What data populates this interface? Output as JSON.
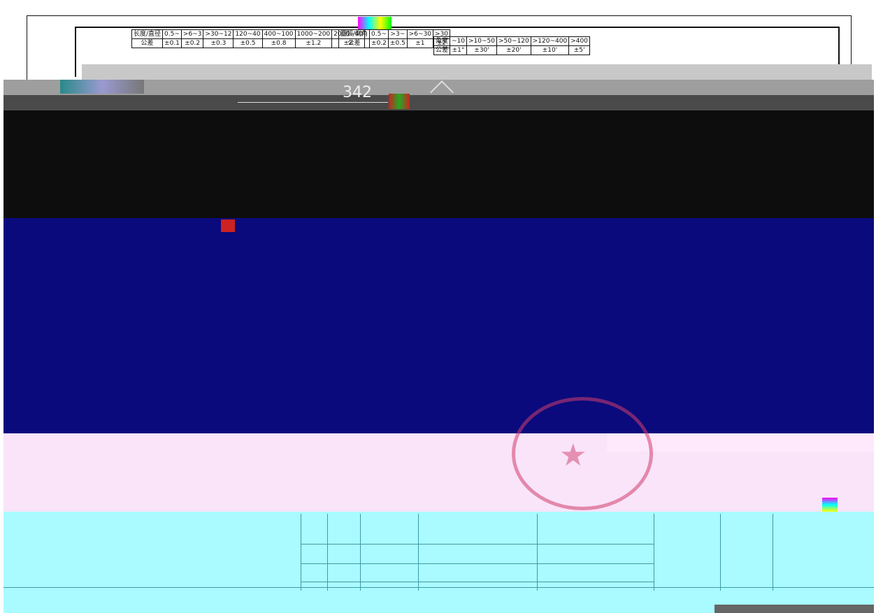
{
  "drawing": {
    "dimension_label": "342",
    "tolerance_table": {
      "length_row": {
        "header": "长度/直径",
        "cells": [
          "0.5~",
          ">6~3",
          ">30~12",
          "120~40",
          "400~100",
          "1000~200",
          "2000~40"
        ]
      },
      "length_tol_row": {
        "header": "公差",
        "cells": [
          "±0.1",
          "±0.2",
          "±0.3",
          "±0.5",
          "±0.8",
          "±1.2",
          "±2"
        ]
      },
      "radius_row": {
        "header": "圆弧/倒角",
        "cells": [
          "0.5~",
          ">3~",
          ">6~30",
          ">30"
        ]
      },
      "radius_tol_row": {
        "header": "公差",
        "cells": [
          "±0.2",
          "±0.5",
          "±1",
          "±2"
        ]
      },
      "angle_row": {
        "header": "角度",
        "cells": [
          "~10",
          ">10~50",
          ">50~120",
          ">120~400",
          ">400"
        ]
      },
      "angle_tol_row": {
        "header": "公差",
        "cells": [
          "±1°",
          "±30'",
          "±20'",
          "±10'",
          "±5'"
        ]
      }
    }
  }
}
